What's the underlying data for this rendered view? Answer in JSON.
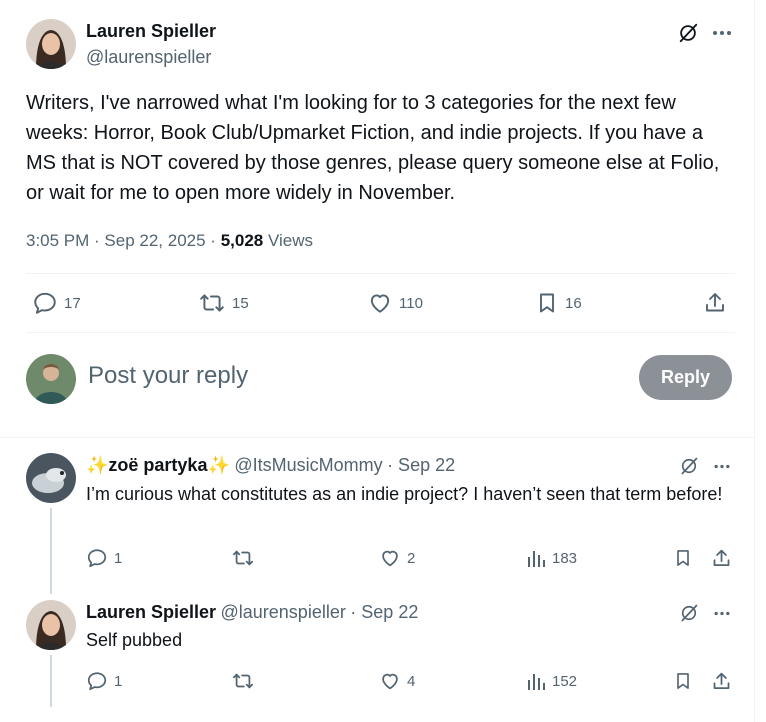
{
  "main_post": {
    "author_name": "Lauren Spieller",
    "author_handle": "@laurenspieller",
    "text": "Writers, I've narrowed what I'm looking for to 3 categories for the next few weeks: Horror, Book Club/Upmarket Fiction, and indie projects. If you have a MS that is NOT covered by those genres, please query someone else at Folio, or wait for me to open more widely in November.",
    "time": "3:05 PM",
    "date": "Sep 22, 2025",
    "views_count": "5,028",
    "views_label": "Views",
    "replies": "17",
    "reposts": "15",
    "likes": "110",
    "bookmarks": "16"
  },
  "composer": {
    "placeholder": "Post your reply",
    "button_label": "Reply"
  },
  "replies": [
    {
      "author_name": "✨zoë partyka✨",
      "author_handle": "@ItsMusicMommy",
      "date": "· Sep 22",
      "text": "I’m curious what constitutes as an indie project? I haven’t seen that term before!",
      "replies": "1",
      "reposts": "",
      "likes": "2",
      "views": "183"
    },
    {
      "author_name": "Lauren Spieller",
      "author_handle": "@laurenspieller",
      "date": "· Sep 22",
      "text": "Self pubbed",
      "replies": "1",
      "reposts": "",
      "likes": "4",
      "views": "152"
    }
  ],
  "icons": {
    "grok": "grok-icon",
    "more": "more-icon",
    "reply": "reply-icon",
    "repost": "repost-icon",
    "like": "like-icon",
    "bookmark": "bookmark-icon",
    "share": "share-icon",
    "views": "views-icon"
  },
  "colors": {
    "text": "#0f1419",
    "secondary": "#536471",
    "border": "#eff3f4",
    "reply_button": "#8b9196",
    "thread_line": "#cfd9de"
  }
}
